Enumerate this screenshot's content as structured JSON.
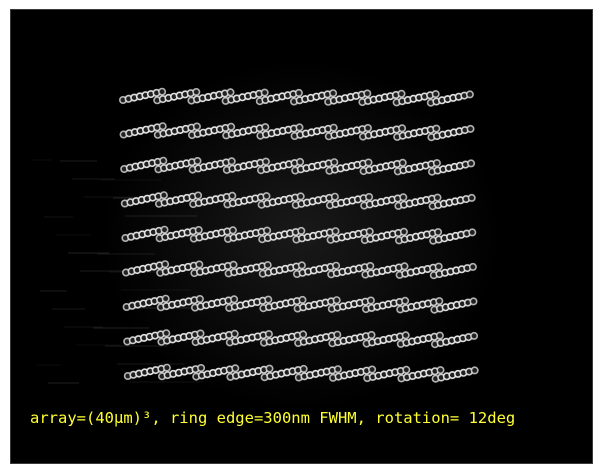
{
  "image": {
    "subject": "grid of diagonal bead-like particle rows on black background",
    "background_color": "#000000",
    "particle_color": "#e6e6e6",
    "grid": {
      "rows": 9,
      "columns": 10,
      "beads_per_segment": 8,
      "rotation_deg": 12
    }
  },
  "caption": {
    "text": "array=(40μm)³, ring edge=300nm FWHM, rotation= 12deg",
    "color": "#ffff33"
  }
}
